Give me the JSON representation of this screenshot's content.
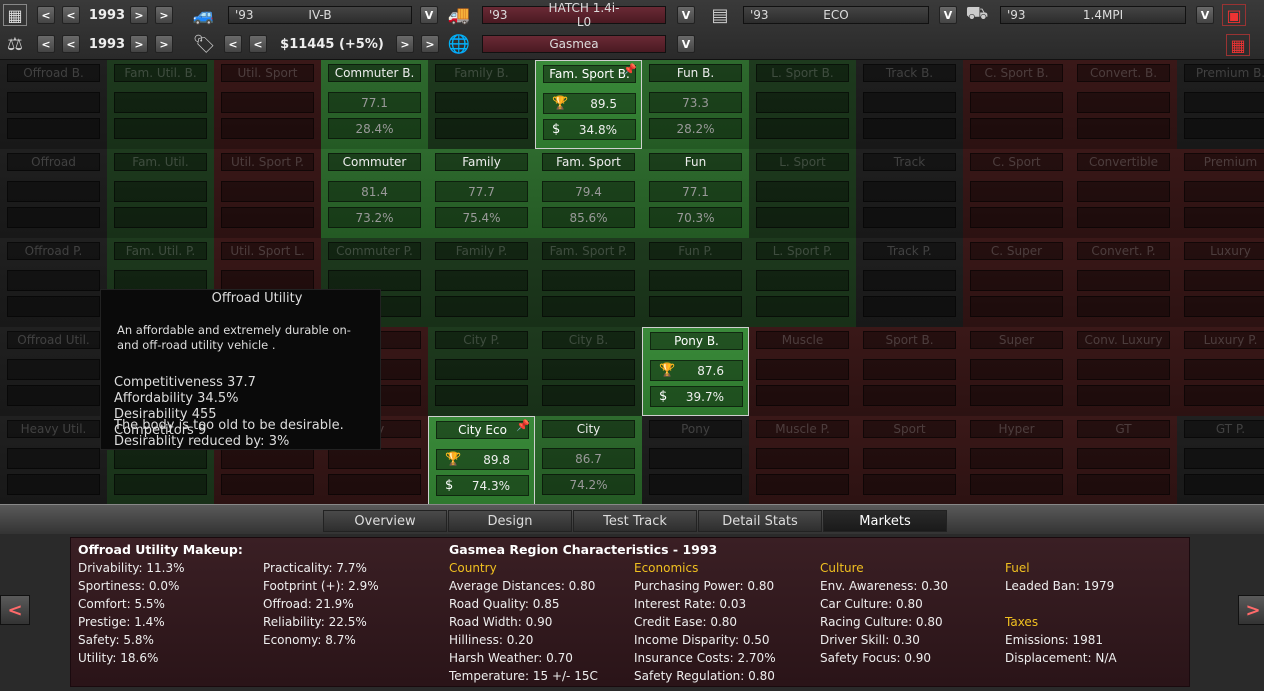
{
  "toolbar": {
    "row1": {
      "year": "1993",
      "chassis": {
        "year": "'93",
        "name": "IV-B"
      },
      "body": {
        "year": "'93",
        "name": "HATCH 1.4i-L0"
      },
      "trim": {
        "year": "'93",
        "name": "ECO"
      },
      "engine": {
        "year": "'93",
        "name": "1.4MPI"
      },
      "dropdown": "V",
      "prev": "<",
      "next": ">"
    },
    "row2": {
      "year": "1993",
      "price": "$11445 (+5%)",
      "region": "Gasmea",
      "dropdown": "V",
      "prev": "<",
      "next": ">"
    }
  },
  "grid": {
    "columns": [
      {
        "cells": [
          {
            "label": "Offroad B."
          },
          {
            "label": "Offroad"
          },
          {
            "label": "Offroad P."
          },
          {
            "label": "Offroad Util."
          },
          {
            "label": "Heavy Util."
          }
        ]
      },
      {
        "cells": [
          {
            "label": "Fam. Util. B."
          },
          {
            "label": "Fam. Util."
          },
          {
            "label": "Fam. Util. P."
          },
          {
            "label": ""
          },
          {
            "label": ""
          }
        ]
      },
      {
        "cells": [
          {
            "label": "Util. Sport"
          },
          {
            "label": "Util. Sport P."
          },
          {
            "label": "Util. Sport L."
          },
          {
            "label": ""
          },
          {
            "label": ""
          }
        ]
      },
      {
        "cells": [
          {
            "label": "Commuter B.",
            "v1": "77.1",
            "v2": "28.4%"
          },
          {
            "label": "Commuter",
            "v1": "81.4",
            "v2": "73.2%"
          },
          {
            "label": "Commuter P."
          },
          {
            "label": "P."
          },
          {
            "label": "ery"
          }
        ]
      },
      {
        "cells": [
          {
            "label": "Family B."
          },
          {
            "label": "Family",
            "v1": "77.7",
            "v2": "75.4%"
          },
          {
            "label": "Family P."
          },
          {
            "label": "City P."
          },
          {
            "label": "City Eco",
            "v1": "89.8",
            "v2": "74.3%"
          }
        ]
      },
      {
        "cells": [
          {
            "label": "Fam. Sport B.",
            "v1": "89.5",
            "v2": "34.8%"
          },
          {
            "label": "Fam. Sport",
            "v1": "79.4",
            "v2": "85.6%"
          },
          {
            "label": "Fam. Sport P."
          },
          {
            "label": "City B."
          },
          {
            "label": "City",
            "v1": "86.7",
            "v2": "74.2%"
          }
        ]
      },
      {
        "cells": [
          {
            "label": "Fun B.",
            "v1": "73.3",
            "v2": "28.2%"
          },
          {
            "label": "Fun",
            "v1": "77.1",
            "v2": "70.3%"
          },
          {
            "label": "Fun P."
          },
          {
            "label": "Pony B.",
            "v1": "87.6",
            "v2": "39.7%"
          },
          {
            "label": "Pony"
          }
        ]
      },
      {
        "cells": [
          {
            "label": "L. Sport B."
          },
          {
            "label": "L. Sport"
          },
          {
            "label": "L. Sport P."
          },
          {
            "label": "Muscle"
          },
          {
            "label": "Muscle P."
          }
        ]
      },
      {
        "cells": [
          {
            "label": "Track B."
          },
          {
            "label": "Track"
          },
          {
            "label": "Track P."
          },
          {
            "label": "Sport B."
          },
          {
            "label": "Sport"
          }
        ]
      },
      {
        "cells": [
          {
            "label": "C. Sport B."
          },
          {
            "label": "C. Sport"
          },
          {
            "label": "C. Super"
          },
          {
            "label": "Super"
          },
          {
            "label": "Hyper"
          }
        ]
      },
      {
        "cells": [
          {
            "label": "Convert. B."
          },
          {
            "label": "Convertible"
          },
          {
            "label": "Convert. P."
          },
          {
            "label": "Conv. Luxury"
          },
          {
            "label": "GT"
          }
        ]
      },
      {
        "cells": [
          {
            "label": "Premium B."
          },
          {
            "label": "Premium"
          },
          {
            "label": "Luxury"
          },
          {
            "label": "Luxury P."
          },
          {
            "label": "GT P."
          }
        ]
      }
    ]
  },
  "tooltip": {
    "title": "Offroad Utility",
    "description": "An affordable and extremely durable on- and off-road utility vehicle .",
    "competitiveness": "Competitiveness 37.7",
    "affordability": "Affordability 34.5%",
    "desirability": "Desirability 455",
    "competitors": "Competitors 9",
    "warning1": "The body is too old to be desirable.",
    "warning2": "Desirablity reduced by: 3%"
  },
  "tabs": [
    "Overview",
    "Design",
    "Test Track",
    "Detail Stats",
    "Markets"
  ],
  "makeup": {
    "title": "Offroad Utility Makeup:",
    "col1": [
      "Drivability: 11.3%",
      "Sportiness: 0.0%",
      "Comfort: 5.5%",
      "Prestige: 1.4%",
      "Safety: 5.8%",
      "Utility: 18.6%"
    ],
    "col2": [
      "Practicality: 7.7%",
      "Footprint (+): 2.9%",
      "Offroad: 21.9%",
      "Reliability: 22.5%",
      "Economy: 8.7%"
    ]
  },
  "region": {
    "title": "Gasmea Region Characteristics - 1993",
    "country_h": "Country",
    "country": [
      "Average Distances:  0.80",
      "Road Quality:  0.85",
      "Road Width:  0.90",
      "Hilliness:  0.20",
      "Harsh Weather:  0.70",
      "Temperature:  15 +/- 15C"
    ],
    "economics_h": "Economics",
    "economics": [
      "Purchasing Power:  0.80",
      "Interest Rate:  0.03",
      "Credit Ease:  0.80",
      "Income Disparity:  0.50",
      "Insurance Costs:  2.70%",
      "Safety Regulation:  0.80"
    ],
    "culture_h": "Culture",
    "culture": [
      "Env. Awareness:  0.30",
      "Car Culture:  0.80",
      "Racing Culture:  0.80",
      "Driver Skill:  0.30",
      "Safety Focus:  0.90"
    ],
    "fuel_h": "Fuel",
    "fuel": [
      "Leaded Ban:  1979"
    ],
    "taxes_h": "Taxes",
    "taxes": [
      "Emissions:  1981",
      "Displacement: N/A"
    ]
  },
  "nav": {
    "prev": "<",
    "next": ">"
  },
  "colors": {
    "green": "#2f6b2f",
    "red": "#5a1e1e",
    "accent_yellow": "#f0c020"
  },
  "icons": [
    "calendar-icon",
    "scales-icon",
    "car-chassis-icon",
    "price-tag-icon",
    "truck-icon",
    "globe-icon",
    "film-strip-icon",
    "engine-icon",
    "save-icon",
    "grid-icon",
    "trophy-icon",
    "dollar-icon",
    "pin-icon"
  ]
}
